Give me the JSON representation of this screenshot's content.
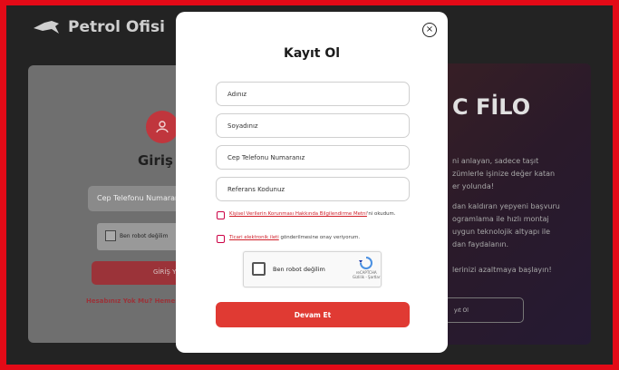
{
  "brand": {
    "name": "Petrol Ofisi"
  },
  "background": {
    "login": {
      "title": "Giriş Y",
      "phone_placeholder": "Cep Telefonu Numarar",
      "captcha_label": "Ben robot değilim",
      "button_label": "GİRİŞ YA",
      "signup_link": "Hesabınız Yok Mu? Hemer"
    },
    "filo": {
      "title": "C FİLO",
      "p1": "ni anlayan, sadece taşıt\nzümlerle işinize değer katan\ner yolunda!",
      "p2": "dan kaldıran yepyeni başvuru\nogramlama ile hızlı montaj\nuygun teknolojik altyapı ile\ndan faydalanın.",
      "p3": "lerinizi azaltmaya başlayın!",
      "button_label": "yıt Ol"
    }
  },
  "modal": {
    "close_symbol": "×",
    "title": "Kayıt Ol",
    "fields": {
      "name": "Adınız",
      "surname": "Soyadınız",
      "phone": "Cep Telefonu Numaranız",
      "referral": "Referans Kodunuz"
    },
    "consent1_link": "Kişisel Verilerin Korunması Hakkında Bilgilendirme Metni",
    "consent1_suffix": "'ni okudum.",
    "consent2_link": "Ticari elektronik ileti",
    "consent2_suffix": " gönderilmesine onay veriyorum.",
    "captcha": {
      "label": "Ben robot değilim",
      "brand": "reCAPTCHA",
      "terms": "Gizlilik - Şartlar"
    },
    "submit_label": "Devam Et"
  },
  "colors": {
    "accent": "#e03a33",
    "frame": "#e30a17"
  }
}
